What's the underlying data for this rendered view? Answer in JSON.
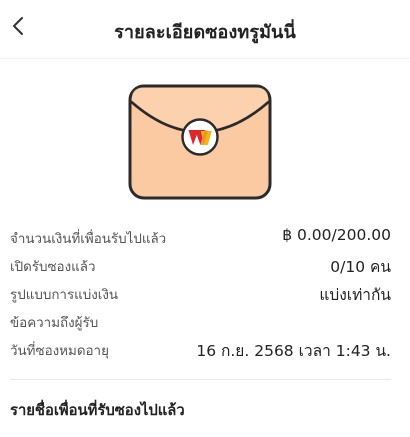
{
  "header": {
    "title": "รายละเอียดซองทรูมันนี่",
    "back_icon": "chevron-left-icon"
  },
  "envelope": {
    "icon": "red-envelope-icon",
    "logo_text": "W",
    "colors": {
      "body": "#fbc9a2",
      "outline": "#2a2a2a",
      "logo_red": "#e1262c",
      "logo_yellow": "#f5b51a"
    }
  },
  "details": [
    {
      "label": "จำนวนเงินที่เพื่อนรับไปแล้ว",
      "value": "฿ 0.00/200.00"
    },
    {
      "label": "เปิดรับซองแล้ว",
      "value": "0/10 คน"
    },
    {
      "label": "รูปแบบการแบ่งเงิน",
      "value": "แบ่งเท่ากัน"
    },
    {
      "label": "ข้อความถึงผู้รับ",
      "value": ""
    },
    {
      "label": "วันที่ซองหมดอายุ",
      "value": "16 ก.ย. 2568 เวลา 1:43 น."
    }
  ],
  "receivers": {
    "section_title": "รายชื่อเพื่อนที่รับซองไปแล้ว"
  }
}
